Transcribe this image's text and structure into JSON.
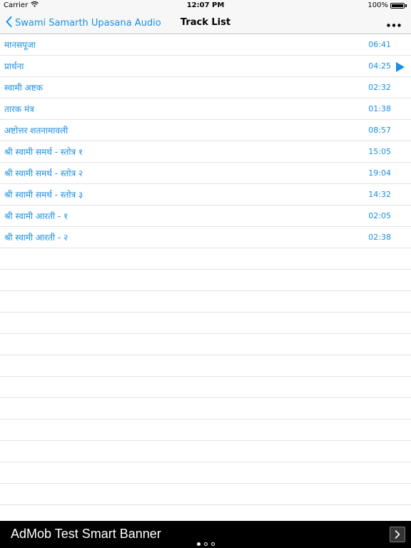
{
  "status_bar": {
    "carrier": "Carrier",
    "time": "12:07 PM",
    "battery": "100%",
    "battery_level": 1.0
  },
  "nav": {
    "back_label": "Swami Samarth Upasana Audio",
    "title": "Track List",
    "more_icon": "ellipsis-icon"
  },
  "colors": {
    "accent": "#1a8fe3",
    "nav_bg": "#f7f7f7",
    "separator": "#e3e3e6",
    "ad_bg": "#000000"
  },
  "tracks": [
    {
      "name": "मानसपूजा",
      "duration": "06:41"
    },
    {
      "name": "प्रार्थना",
      "duration": "04:25",
      "playing": true
    },
    {
      "name": "स्वामी अष्टक",
      "duration": "02:32"
    },
    {
      "name": "तारक मंत्र",
      "duration": "01:38"
    },
    {
      "name": "अष्टोत्तर शतनामावली",
      "duration": "08:57"
    },
    {
      "name": "श्री स्वामी समर्थ - स्तोत्र १",
      "duration": "15:05"
    },
    {
      "name": "श्री स्वामी समर्थ - स्तोत्र २",
      "duration": "19:04"
    },
    {
      "name": "श्री स्वामी समर्थ - स्तोत्र ३",
      "duration": "14:32"
    },
    {
      "name": "श्री स्वामी आरती - १",
      "duration": "02:05"
    },
    {
      "name": "श्री स्वामी आरती - २",
      "duration": "02:38"
    }
  ],
  "ad": {
    "text": "AdMob Test Smart Banner",
    "page_count": 3,
    "active_page": 1
  }
}
